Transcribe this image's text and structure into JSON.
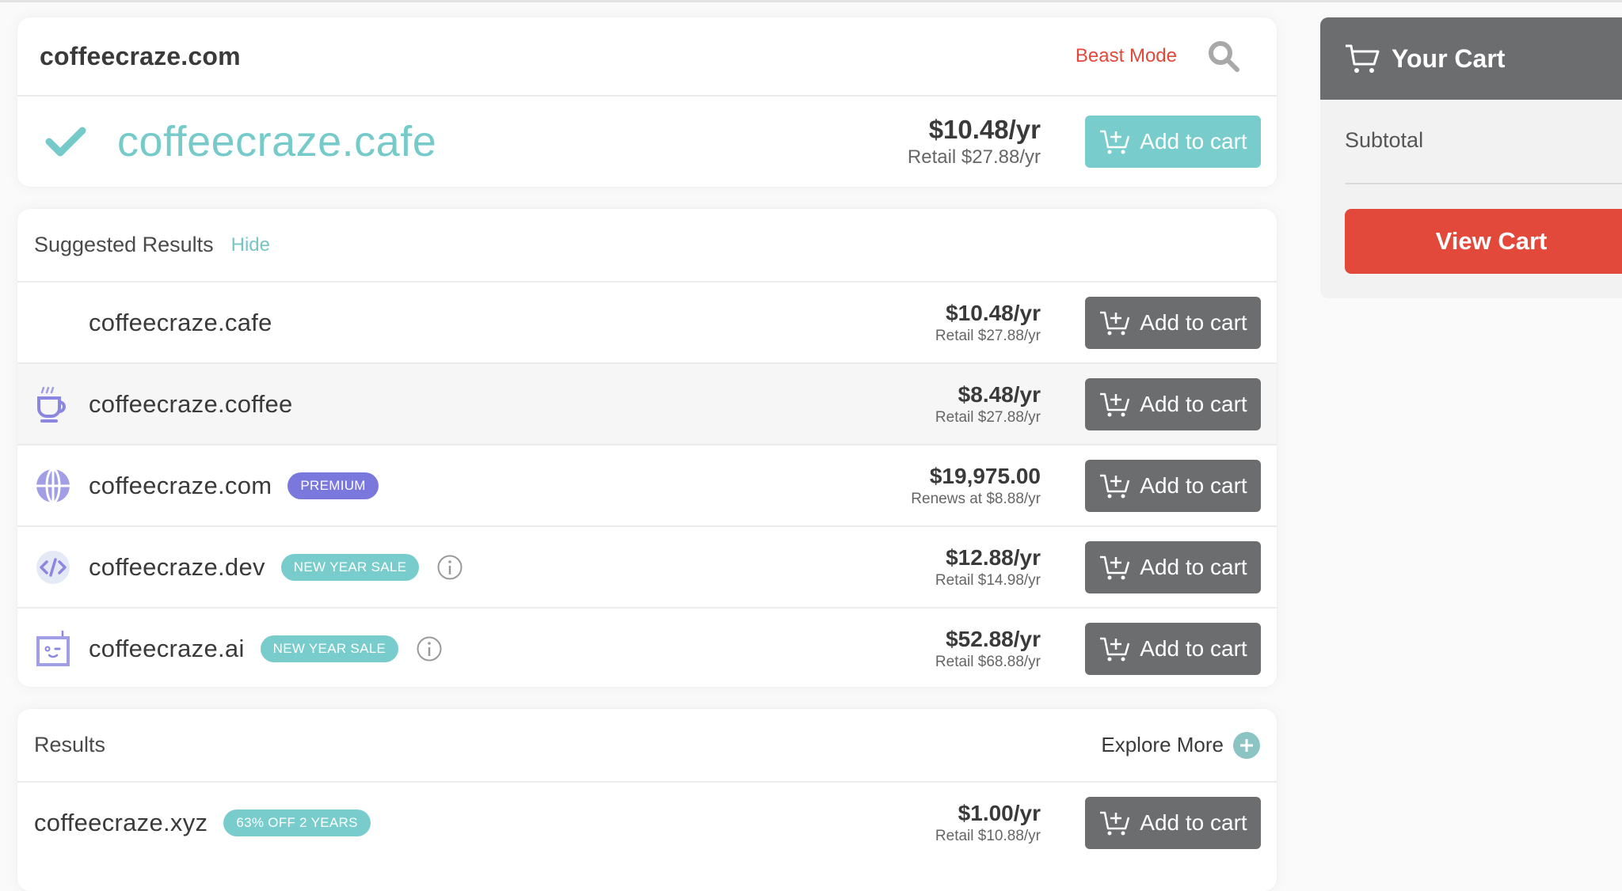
{
  "search": {
    "query": "coffeecraze.com",
    "beast_mode_label": "Beast Mode",
    "search_icon": "search-icon"
  },
  "selected": {
    "icon": "check-icon",
    "domain": "coffeecraze.cafe",
    "price": "$10.48/yr",
    "sub_price": "Retail $27.88/yr",
    "button_label": "Add to cart"
  },
  "suggested": {
    "title": "Suggested Results",
    "hide_label": "Hide",
    "rows": [
      {
        "icon": "none",
        "domain": "coffeecraze.cafe",
        "badge": "",
        "info": false,
        "price": "$10.48/yr",
        "sub_price": "Retail $27.88/yr",
        "button_label": "Add to cart"
      },
      {
        "icon": "coffee-cup-icon",
        "domain": "coffeecraze.coffee",
        "badge": "",
        "info": false,
        "price": "$8.48/yr",
        "sub_price": "Retail $27.88/yr",
        "button_label": "Add to cart"
      },
      {
        "icon": "globe-icon",
        "domain": "coffeecraze.com",
        "badge": "PREMIUM",
        "info": false,
        "price": "$19,975.00",
        "sub_price": "Renews at $8.88/yr",
        "button_label": "Add to cart"
      },
      {
        "icon": "code-icon",
        "domain": "coffeecraze.dev",
        "badge": "NEW YEAR SALE",
        "info": true,
        "price": "$12.88/yr",
        "sub_price": "Retail $14.98/yr",
        "button_label": "Add to cart"
      },
      {
        "icon": "robot-icon",
        "domain": "coffeecraze.ai",
        "badge": "NEW YEAR SALE",
        "info": true,
        "price": "$52.88/yr",
        "sub_price": "Retail $68.88/yr",
        "button_label": "Add to cart"
      }
    ]
  },
  "results": {
    "title": "Results",
    "explore_label": "Explore More",
    "rows": [
      {
        "domain": "coffeecraze.xyz",
        "badge": "63% OFF 2 YEARS",
        "price": "$1.00/yr",
        "sub_price": "Retail $10.88/yr",
        "button_label": "Add to cart"
      }
    ]
  },
  "cart": {
    "title": "Your Cart",
    "subtotal_label": "Subtotal",
    "view_cart_label": "View Cart"
  },
  "colors": {
    "accent_teal": "#78cdcc",
    "accent_red": "#e2483a",
    "premium_purple": "#7a78dc",
    "button_gray": "#6c6d6f"
  }
}
